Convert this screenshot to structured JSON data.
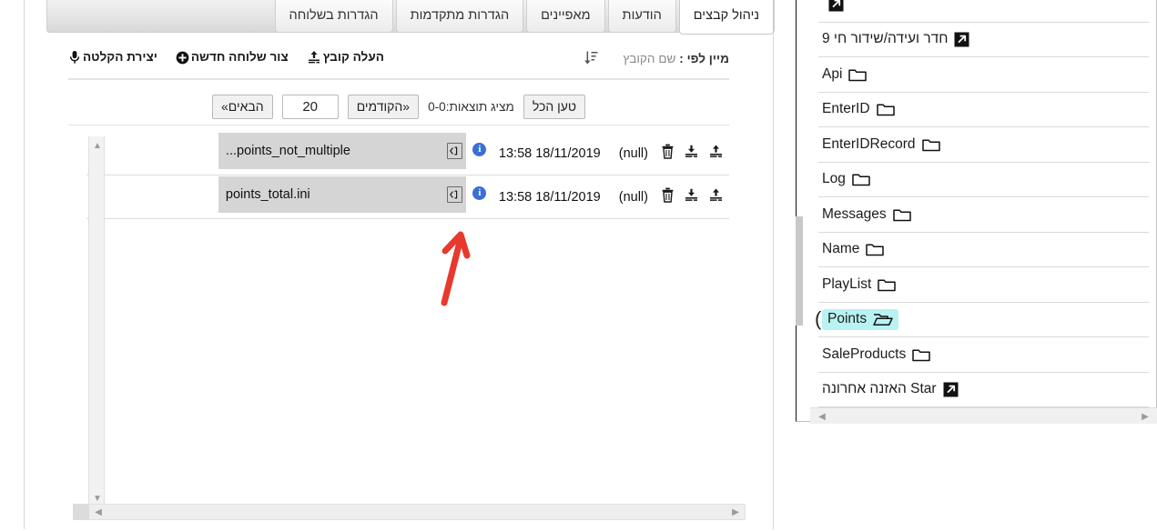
{
  "tabs": [
    {
      "label": "ניהול קבצים",
      "active": true
    },
    {
      "label": "הודעות",
      "active": false
    },
    {
      "label": "מאפיינים",
      "active": false
    },
    {
      "label": "הגדרות מתקדמות",
      "active": false
    },
    {
      "label": "הגדרות בשלוחה",
      "active": false
    }
  ],
  "toolbar": {
    "upload_file_label": "העלה קובץ",
    "upload_file_icon": "upload-icon",
    "create_extension_label": "צור שלוחה חדשה",
    "create_extension_icon": "plus-circle-icon",
    "create_recording_label": "יצירת הקלטה",
    "create_recording_icon": "microphone-icon",
    "sort_prefix": "מיין לפי :",
    "sort_value": "שם הקובץ",
    "sort_icon": "sort-descending-icon"
  },
  "pager": {
    "next_label": "הבאים»",
    "page_size": "20",
    "page_size_placeholder": "20",
    "prev_label": "«הקודמים",
    "status": "מציג תוצאות:0-0",
    "load_all_label": "טען הכל"
  },
  "file_list": {
    "rows": [
      {
        "name": "...points_not_multiple",
        "name_icon": "code-file-icon",
        "info_icon": "info-icon",
        "info_glyph": "i",
        "date": "13:58 18/11/2019",
        "owner": "(null)",
        "actions": [
          {
            "name": "upload-icon",
            "title": "העלה"
          },
          {
            "name": "download-icon",
            "title": "הורד"
          },
          {
            "name": "trash-icon",
            "title": "מחק"
          }
        ]
      },
      {
        "name": "points_total.ini",
        "name_icon": "code-file-icon",
        "info_icon": "info-icon",
        "info_glyph": "i",
        "date": "13:58 18/11/2019",
        "owner": "(null)",
        "actions": [
          {
            "name": "upload-icon",
            "title": "העלה"
          },
          {
            "name": "download-icon",
            "title": "הורד"
          },
          {
            "name": "trash-icon",
            "title": "מחק"
          }
        ]
      }
    ]
  },
  "folder_panel": {
    "items": [
      {
        "label": "",
        "icon": "external-link-icon",
        "partial": true,
        "selected": false
      },
      {
        "label": "חדר ועידה/שידור חי 9",
        "icon": "external-link-icon",
        "selected": false
      },
      {
        "label": "Api",
        "icon": "folder-icon",
        "selected": false
      },
      {
        "label": "EnterID",
        "icon": "folder-icon",
        "selected": false
      },
      {
        "label": "EnterIDRecord",
        "icon": "folder-icon",
        "selected": false
      },
      {
        "label": "Log",
        "icon": "folder-icon",
        "selected": false
      },
      {
        "label": "Messages",
        "icon": "folder-icon",
        "selected": false
      },
      {
        "label": "Name",
        "icon": "folder-icon",
        "selected": false
      },
      {
        "label": "PlayList",
        "icon": "folder-icon",
        "selected": false
      },
      {
        "label": "Points",
        "icon": "folder-open-icon",
        "selected": true
      },
      {
        "label": "SaleProducts",
        "icon": "folder-icon",
        "selected": false
      },
      {
        "label": "Star האזנה אחרונה",
        "icon": "external-link-icon",
        "selected": false
      },
      {
        "label": "",
        "icon": "folder-icon",
        "partial": true,
        "selected": false
      }
    ]
  },
  "colors": {
    "selection_highlight": "#b8f2f2",
    "info_badge": "#3b6fd4",
    "row_name_cell": "#d5d5d5",
    "annotation_arrow": "#e8392e"
  },
  "annotation": {
    "arrow_icon": "red-arrow-up-annotation"
  }
}
